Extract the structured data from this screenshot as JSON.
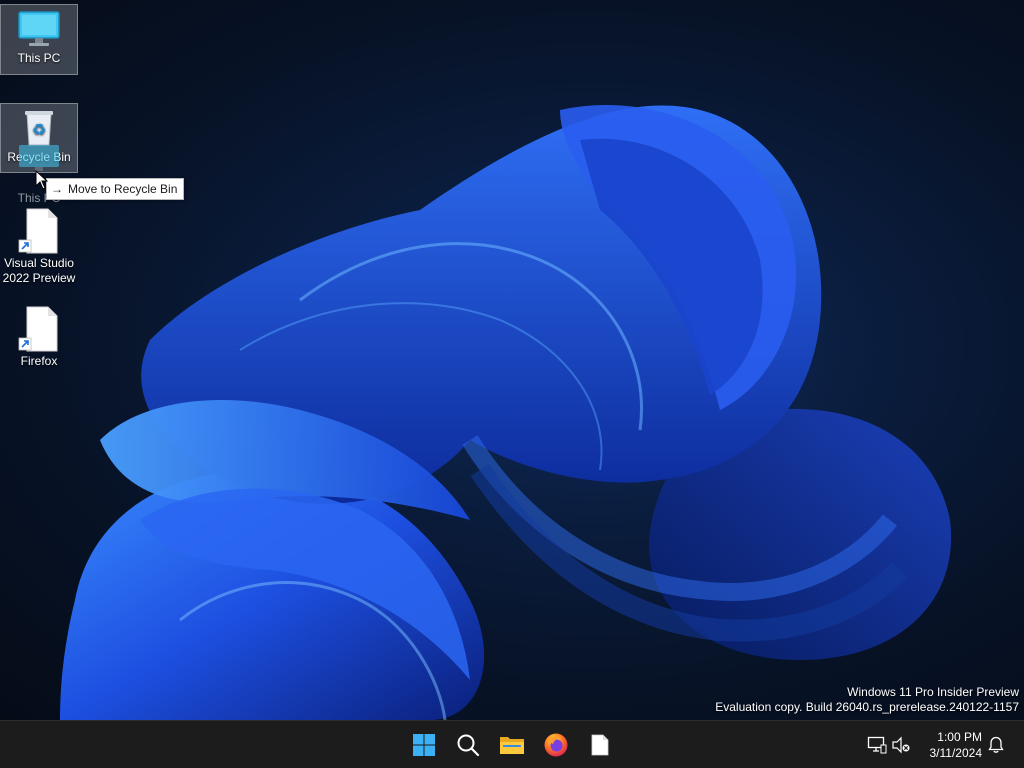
{
  "desktop": {
    "icons": [
      {
        "label": "This PC"
      },
      {
        "label": "Recycle Bin"
      },
      {
        "label": "Visual Studio 2022 Preview"
      },
      {
        "label": "Firefox"
      }
    ],
    "drag_ghost_label": "This PC",
    "tooltip": {
      "text": "Move to Recycle Bin"
    },
    "watermark": {
      "line1": "Windows 11 Pro Insider Preview",
      "line2": "Evaluation copy. Build 26040.rs_prerelease.240122-1157"
    }
  },
  "taskbar": {
    "pinned": [
      {
        "icon": "start-icon"
      },
      {
        "icon": "search-icon"
      },
      {
        "icon": "file-explorer-icon"
      },
      {
        "icon": "firefox-icon"
      },
      {
        "icon": "document-icon"
      }
    ],
    "tray": {
      "time": "1:00 PM",
      "date": "3/11/2024"
    }
  },
  "colors": {
    "accent": "#1f6fff",
    "taskbar_bg": "#1c1c1c",
    "desktop_bg": "#071226"
  }
}
